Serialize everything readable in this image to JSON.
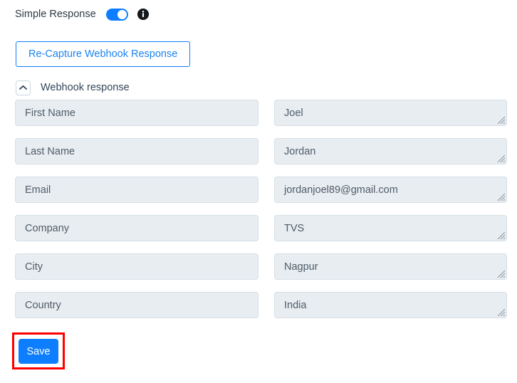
{
  "simple_response": {
    "label": "Simple Response",
    "toggle_state": "on",
    "info_icon": "info-icon",
    "toggle_on_color": "#0d7eff",
    "info_icon_color": "#16191c"
  },
  "recapture_button": {
    "label": "Re-Capture Webhook Response",
    "text_color": "#1d84f0",
    "border_color": "#0d7eff"
  },
  "section": {
    "title": "Webhook response",
    "collapse_icon": "chevron-up-icon",
    "expanded": true
  },
  "fields": [
    {
      "key": "First Name",
      "value": "Joel"
    },
    {
      "key": "Last Name",
      "value": "Jordan"
    },
    {
      "key": "Email",
      "value": "jordanjoel89@gmail.com"
    },
    {
      "key": "Company",
      "value": "TVS"
    },
    {
      "key": "City",
      "value": "Nagpur"
    },
    {
      "key": "Country",
      "value": "India"
    }
  ],
  "save_button": {
    "label": "Save",
    "background_color": "#0d7eff",
    "text_color": "#ffffff",
    "highlight_color": "#ff0000"
  },
  "theme": {
    "page_background": "#ffffff",
    "field_background": "#e8edf1",
    "field_border": "#d6dfe7",
    "text_color": "#33475b"
  }
}
